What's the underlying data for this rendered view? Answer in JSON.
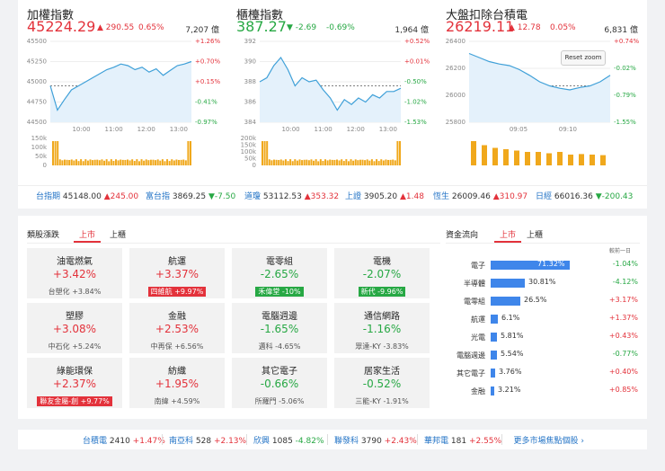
{
  "indices": [
    {
      "title": "加權指數",
      "value": "45224.29",
      "change": "▲ 290.55",
      "pct": "0.65%",
      "volume": "7,207 億",
      "yticks": [
        "45500",
        "45250",
        "45000",
        "44750",
        "44500"
      ],
      "rticks": [
        "+1.26%",
        "+0.70%",
        "+0.15%",
        "-0.41%",
        "-0.97%"
      ],
      "xticks": [
        "10:00",
        "11:00",
        "12:00",
        "13:00"
      ],
      "vticks": [
        "150k",
        "100k",
        "50k",
        "0"
      ]
    },
    {
      "title": "櫃檯指數",
      "value": "387.27",
      "change": "▼ -2.69",
      "pct": "-0.69%",
      "volume": "1,964 億",
      "yticks": [
        "392",
        "390",
        "388",
        "386",
        "384"
      ],
      "rticks": [
        "+0.52%",
        "+0.01%",
        "-0.50%",
        "-1.02%",
        "-1.53%"
      ],
      "xticks": [
        "10:00",
        "11:00",
        "12:00",
        "13:00"
      ],
      "vticks": [
        "200k",
        "150k",
        "100k",
        "50k",
        "0"
      ]
    },
    {
      "title": "大盤扣除台積電",
      "value": "26219.11",
      "change": "▲ 12.78",
      "pct": "0.05%",
      "volume": "6,831 億",
      "yticks": [
        "26400",
        "26200",
        "26000",
        "25800"
      ],
      "rticks": [
        "+0.74%",
        "-0.02%",
        "-0.79%",
        "-1.55%"
      ],
      "xticks": [
        "09:05",
        "09:10"
      ],
      "vticks": []
    }
  ],
  "reset_zoom": "Reset zoom",
  "ticker": [
    {
      "name": "台指期",
      "value": "45148.00",
      "change": "▲245.00",
      "dir": "up"
    },
    {
      "name": "富台指",
      "value": "3869.25",
      "change": "▼-7.50",
      "dir": "down"
    },
    {
      "name": "道瓊",
      "value": "53112.53",
      "change": "▲353.32",
      "dir": "up"
    },
    {
      "name": "上證",
      "value": "3905.20",
      "change": "▲1.48",
      "dir": "up"
    },
    {
      "name": "恆生",
      "value": "26009.46",
      "change": "▲310.97",
      "dir": "up"
    },
    {
      "name": "日經",
      "value": "66016.36",
      "change": "▼-200.43",
      "dir": "down"
    }
  ],
  "sector": {
    "title": "類股漲跌",
    "tabs": [
      "上市",
      "上櫃"
    ],
    "tiles": [
      {
        "name": "油電燃氣",
        "pct": "+3.42%",
        "stock": "台塑化 +3.84%",
        "dir": "up",
        "hl": ""
      },
      {
        "name": "航運",
        "pct": "+3.37%",
        "stock": "四維航 +9.97%",
        "dir": "up",
        "hl": "r"
      },
      {
        "name": "電零組",
        "pct": "-2.65%",
        "stock": "禾偉堂 -10%",
        "dir": "down",
        "hl": "g"
      },
      {
        "name": "電機",
        "pct": "-2.07%",
        "stock": "新代 -9.96%",
        "dir": "down",
        "hl": "g"
      },
      {
        "name": "塑膠",
        "pct": "+3.08%",
        "stock": "中石化 +5.24%",
        "dir": "up",
        "hl": ""
      },
      {
        "name": "金融",
        "pct": "+2.53%",
        "stock": "中再保 +6.56%",
        "dir": "up",
        "hl": ""
      },
      {
        "name": "電腦週邊",
        "pct": "-1.65%",
        "stock": "邁科 -4.65%",
        "dir": "down",
        "hl": ""
      },
      {
        "name": "通信網路",
        "pct": "-1.16%",
        "stock": "眾達-KY -3.83%",
        "dir": "down",
        "hl": ""
      },
      {
        "name": "綠能環保",
        "pct": "+2.37%",
        "stock": "聯友金屬-創 +9.77%",
        "dir": "up",
        "hl": "r"
      },
      {
        "name": "紡織",
        "pct": "+1.95%",
        "stock": "南緯 +4.59%",
        "dir": "up",
        "hl": ""
      },
      {
        "name": "其它電子",
        "pct": "-0.66%",
        "stock": "所羅門 -5.06%",
        "dir": "down",
        "hl": ""
      },
      {
        "name": "居家生活",
        "pct": "-0.52%",
        "stock": "三能-KY -1.91%",
        "dir": "down",
        "hl": ""
      }
    ]
  },
  "flow": {
    "title": "資金流向",
    "tabs": [
      "上市",
      "上櫃"
    ],
    "note": "較前一日",
    "rows": [
      {
        "name": "電子",
        "share": "71.32%",
        "frac": 0.7132,
        "change": "-1.04%",
        "dir": "down"
      },
      {
        "name": "半導體",
        "share": "30.81%",
        "frac": 0.3081,
        "change": "-4.12%",
        "dir": "down"
      },
      {
        "name": "電零組",
        "share": "26.5%",
        "frac": 0.265,
        "change": "+3.17%",
        "dir": "up"
      },
      {
        "name": "航運",
        "share": "6.1%",
        "frac": 0.061,
        "change": "+1.37%",
        "dir": "up"
      },
      {
        "name": "光電",
        "share": "5.81%",
        "frac": 0.0581,
        "change": "+0.43%",
        "dir": "up"
      },
      {
        "name": "電腦週邊",
        "share": "5.54%",
        "frac": 0.0554,
        "change": "-0.77%",
        "dir": "down"
      },
      {
        "name": "其它電子",
        "share": "3.76%",
        "frac": 0.0376,
        "change": "+0.40%",
        "dir": "up"
      },
      {
        "name": "金融",
        "share": "3.21%",
        "frac": 0.0321,
        "change": "+0.85%",
        "dir": "up"
      }
    ]
  },
  "bottom": [
    {
      "name": "台積電",
      "value": "2410",
      "change": "+1.47%",
      "dir": "up"
    },
    {
      "name": "南亞科",
      "value": "528",
      "change": "+2.13%",
      "dir": "up"
    },
    {
      "name": "欣興",
      "value": "1085",
      "change": "-4.82%",
      "dir": "down"
    },
    {
      "name": "聯發科",
      "value": "3790",
      "change": "+2.43%",
      "dir": "up"
    },
    {
      "name": "華邦電",
      "value": "181",
      "change": "+2.55%",
      "dir": "up"
    }
  ],
  "more_label": "更多市場焦點個股 ›"
}
